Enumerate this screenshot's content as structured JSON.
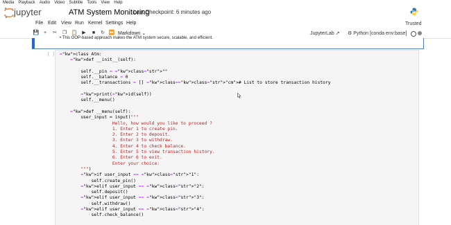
{
  "system_menu": [
    "Media",
    "Playback",
    "Audio",
    "Video",
    "Subtitle",
    "Tools",
    "View",
    "Help"
  ],
  "header": {
    "brand": "jupyter",
    "notebook_title": "ATM System Monitoring",
    "checkpoint": "Last Checkpoint: 6 minutes ago"
  },
  "menu": [
    "File",
    "Edit",
    "View",
    "Run",
    "Kernel",
    "Settings",
    "Help"
  ],
  "trusted": "Trusted",
  "toolbar": {
    "cell_type": "Markdown",
    "jupyterlab": "JupyterLab",
    "kernel": "Python [conda env:base]"
  },
  "markdown_cell": {
    "text": "This OOP-based approach makes the ATM system secure, scalable, and efficient."
  },
  "code_cell": {
    "prompt": "[ ]:",
    "lines": [
      "class Atm:",
      "    def __init__(self):",
      "",
      "        self.__pin = \"\"",
      "        self.__balance = 0",
      "        self.__transactions = [] # List to store transaction history",
      "",
      "        print(id(self))",
      "        self.__menu()",
      "",
      "    def __menu(self):",
      "        user_input = input(\"\"\"",
      "                    Hello, how would you like to proceed ?",
      "                    1. Enter 1 to create pin.",
      "                    2. Enter 2 to deposit.",
      "                    3. Enter 3 to withdraw.",
      "                    4. Enter 4 to check balance.",
      "                    5. Enter 5 to view transaction history.",
      "                    6. Enter 6 to exit.",
      "                    Enter your choice:",
      "        \"\"\")",
      "        if user_input == \"1\":",
      "            self.create_pin()",
      "        elif user_input == \"2\":",
      "            self.deposit()",
      "        elif user_input == \"3\":",
      "            self.withdraw()",
      "        elif user_input == \"4\":",
      "            self.check_balance()"
    ]
  }
}
